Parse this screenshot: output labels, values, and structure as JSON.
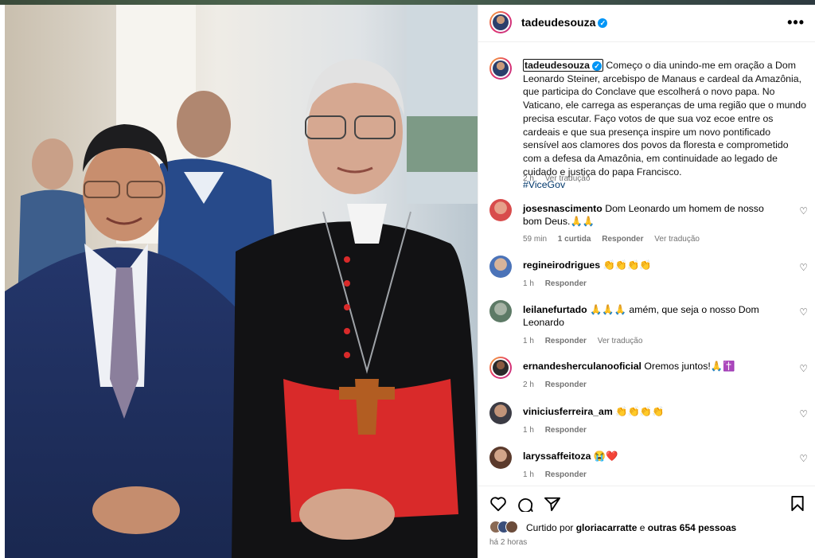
{
  "post": {
    "username": "tadeudesouza",
    "caption": "Começo o dia unindo-me em oração a Dom Leonardo Steiner, arcebispo de Manaus e cardeal da Amazônia, que participa do Conclave que escolherá o novo papa. No Vaticano, ele carrega as esperanças de uma região que o mundo precisa escutar. Faço votos de que sua voz ecoe entre os cardeais e que sua presença inspire um novo pontificado sensível aos clamores dos povos da floresta e comprometido com a defesa da Amazônia, em continuidade ao legado de cuidado e justiça do papa Francisco.",
    "hashtag": "#ViceGov",
    "time": "2 h",
    "see_translation": "Ver tradução",
    "more_icon": "more-options-icon"
  },
  "comments": [
    {
      "user": "josesnascimento",
      "text": "Dom Leonardo um homem de nosso bom Deus.🙏🙏",
      "time": "59 min",
      "likes": "1 curtida",
      "reply": "Responder",
      "translate": "Ver tradução"
    },
    {
      "user": "regineirodrigues",
      "text": "👏👏👏👏",
      "time": "1 h",
      "reply": "Responder"
    },
    {
      "user": "leilanefurtado",
      "text": "🙏🙏🙏 amém, que seja o nosso Dom Leonardo",
      "time": "1 h",
      "reply": "Responder",
      "translate": "Ver tradução"
    },
    {
      "user": "ernandesherculanooficial",
      "text": "Oremos juntos!🙏✝️",
      "time": "2 h",
      "reply": "Responder"
    },
    {
      "user": "viniciusferreira_am",
      "text": "👏👏👏👏",
      "time": "1 h",
      "reply": "Responder"
    },
    {
      "user": "laryssaffeitoza",
      "text": "😭❤️",
      "time": "1 h",
      "reply": "Responder"
    }
  ],
  "likes": {
    "prefix": "Curtido por",
    "user": "gloriacarratte",
    "middle": "e",
    "others": "outras 654 pessoas"
  },
  "posted_ago": "há 2 horas",
  "colors": {
    "verified": "#0095f6",
    "link": "#00376b",
    "muted": "#737373"
  }
}
